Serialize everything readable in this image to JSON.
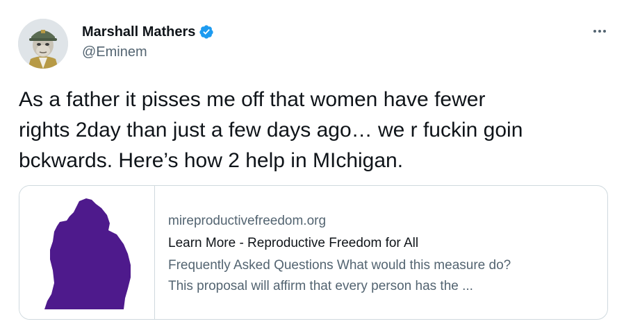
{
  "author": {
    "name": "Marshall Mathers",
    "handle": "@Eminem",
    "verified": true
  },
  "icons": {
    "verified": "verified-badge-icon",
    "more": "more-horizontal-icon"
  },
  "tweet": {
    "text": "As a father it pisses me off that women have fewer\nrights 2day than just a few days ago… we r fuckin goin\nbckwards. Here’s how 2 help in MIchigan."
  },
  "card": {
    "domain": "mireproductivefreedom.org",
    "title": "Learn More - Reproductive Freedom for All",
    "description_line1": "Frequently Asked Questions What would this measure do?",
    "description_line2": "This proposal will affirm that every person has the ..."
  },
  "colors": {
    "verified_blue": "#1d9bf0",
    "michigan_purple": "#4e1a8c",
    "secondary_text": "#536471",
    "border": "#cfd9de"
  }
}
